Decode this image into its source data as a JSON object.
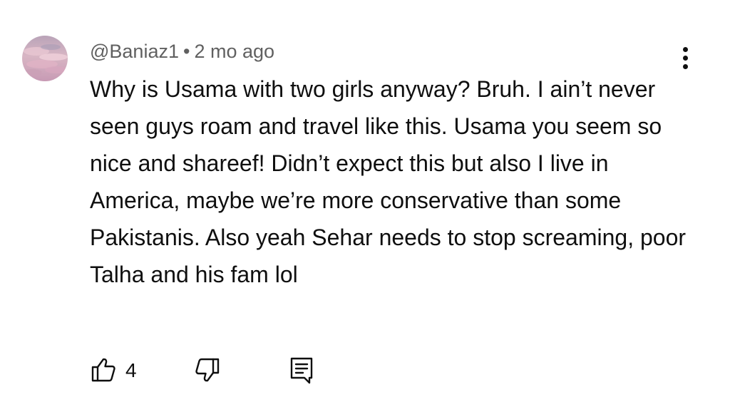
{
  "comment": {
    "author": "@Baniaz1",
    "separator": "•",
    "timestamp": "2 mo ago",
    "text": "Why is Usama with two girls anyway? Bruh. I ain’t never seen guys roam and travel like this. Usama you seem so nice and shareef! Didn’t expect this but also I live in America, maybe we’re more conservative than some Pakistanis. Also yeah Sehar needs to stop screaming, poor Talha and his fam lol",
    "like_count": "4"
  },
  "icons": {
    "avatar": "avatar-image",
    "menu": "more-vert-icon",
    "like": "thumb-up-icon",
    "dislike": "thumb-down-icon",
    "reply": "comment-reply-icon"
  },
  "colors": {
    "text_primary": "#0f0f0f",
    "text_secondary": "#606060",
    "background": "#ffffff"
  }
}
